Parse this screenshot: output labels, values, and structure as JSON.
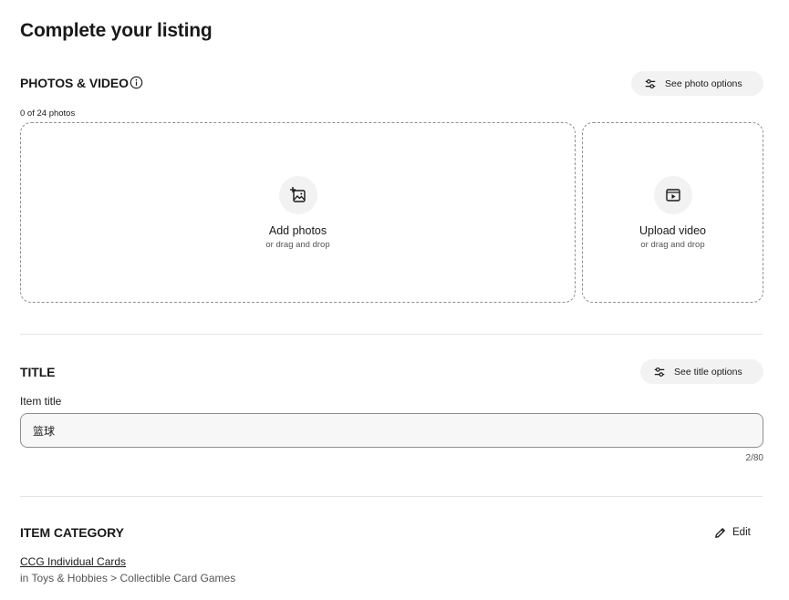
{
  "page": {
    "title": "Complete your listing"
  },
  "photos": {
    "heading": "PHOTOS & VIDEO",
    "options_button": "See photo options",
    "count": "0 of 24 photos",
    "add_photos": {
      "label": "Add photos",
      "sub": "or drag and drop"
    },
    "upload_video": {
      "label": "Upload video",
      "sub": "or drag and drop"
    }
  },
  "title_section": {
    "heading": "TITLE",
    "options_button": "See title options",
    "field_label": "Item title",
    "value": "篮球",
    "char_count": "2/80"
  },
  "category": {
    "heading": "ITEM CATEGORY",
    "edit_label": "Edit",
    "name": "CCG Individual Cards",
    "path": "in Toys & Hobbies > Collectible Card Games"
  },
  "icons": {
    "info": "info-icon",
    "sliders": "sliders-icon",
    "add_photo": "add-photo-icon",
    "video": "video-icon",
    "pencil": "pencil-icon"
  },
  "colors": {
    "text": "#191919",
    "muted": "#555555",
    "pill_bg": "#f2f2f2",
    "border": "#8f8f8f",
    "divider": "#e5e5e5"
  }
}
